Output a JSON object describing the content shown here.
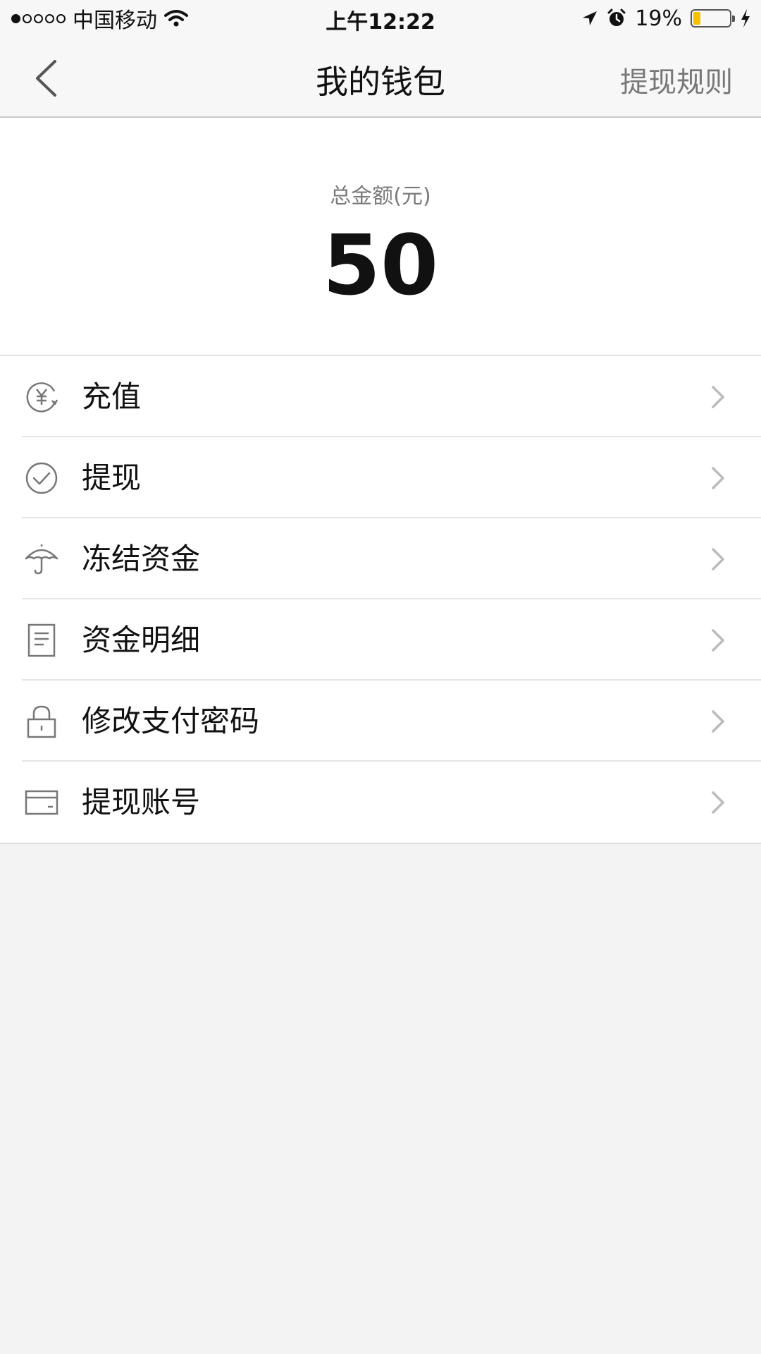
{
  "status_bar": {
    "carrier": "中国移动",
    "time": "上午12:22",
    "battery_percent_text": "19%",
    "battery_level": 0.19,
    "battery_color": "#f5c000",
    "icons": [
      "signal-dots",
      "wifi-icon",
      "location-arrow-icon",
      "alarm-clock-icon",
      "battery-icon",
      "charging-bolt-icon"
    ]
  },
  "nav": {
    "title": "我的钱包",
    "action": "提现规则",
    "back_icon": "chevron-left-icon"
  },
  "balance": {
    "label": "总金额(元)",
    "amount": "50"
  },
  "menu": {
    "items": [
      {
        "label": "充值",
        "icon": "yuan-coin-icon"
      },
      {
        "label": "提现",
        "icon": "check-circle-icon"
      },
      {
        "label": "冻结资金",
        "icon": "umbrella-icon"
      },
      {
        "label": "资金明细",
        "icon": "document-list-icon"
      },
      {
        "label": "修改支付密码",
        "icon": "lock-icon"
      },
      {
        "label": "提现账号",
        "icon": "card-icon"
      }
    ]
  }
}
